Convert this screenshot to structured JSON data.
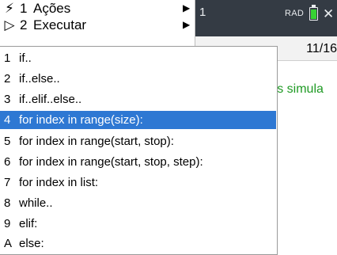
{
  "status_bar": {
    "tab_number": "1",
    "angle_mode": "RAD",
    "colors": {
      "bar": "#343b44",
      "battery": "#37d334"
    }
  },
  "page": {
    "counter": "11/16",
    "background_text": "res simula"
  },
  "main_menu": [
    {
      "icon": "lightning-icon",
      "glyph": "⚡",
      "number": "1",
      "label": "Ações"
    },
    {
      "icon": "play-icon",
      "glyph": "▷",
      "number": "2",
      "label": "Executar"
    }
  ],
  "submenu": {
    "selected_index": 3,
    "selected_color": "#2e78d3",
    "items": [
      {
        "key": "1",
        "label": "if.."
      },
      {
        "key": "2",
        "label": "if..else.."
      },
      {
        "key": "3",
        "label": "if..elif..else.."
      },
      {
        "key": "4",
        "label": "for index in range(size):"
      },
      {
        "key": "5",
        "label": "for index in range(start, stop):"
      },
      {
        "key": "6",
        "label": "for index in range(start, stop, step):"
      },
      {
        "key": "7",
        "label": "for index in list:"
      },
      {
        "key": "8",
        "label": "while.."
      },
      {
        "key": "9",
        "label": "elif:"
      },
      {
        "key": "A",
        "label": "else:"
      }
    ]
  }
}
